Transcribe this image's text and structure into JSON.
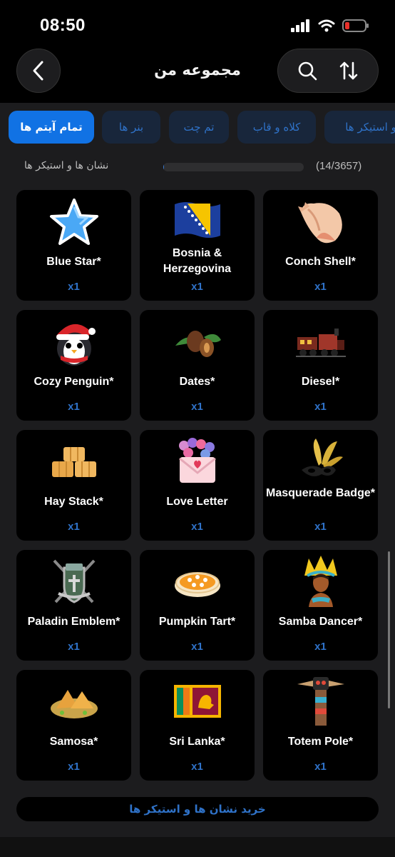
{
  "status": {
    "time": "08:50"
  },
  "header": {
    "title": "مجموعه من",
    "back_icon": "chevron-left-icon",
    "search_icon": "search-icon",
    "sort_icon": "sort-arrows-icon"
  },
  "tabs": [
    {
      "label": "تمام آیتم ها",
      "active": true
    },
    {
      "label": "بنر ها",
      "active": false
    },
    {
      "label": "تم چت",
      "active": false
    },
    {
      "label": "کلاه و قاب",
      "active": false
    },
    {
      "label": "نشان ها و استیکر ها",
      "active": false
    }
  ],
  "progress": {
    "count": "(14/3657)",
    "fraction": 0.0038,
    "label": "نشان ها و استیکر ها"
  },
  "items": [
    {
      "name": "Blue Star*",
      "qty": "x1",
      "icon": "blue-star-icon"
    },
    {
      "name": "Bosnia & Herzegovina",
      "qty": "x1",
      "icon": "bosnia-flag-icon"
    },
    {
      "name": "Conch Shell*",
      "qty": "x1",
      "icon": "conch-shell-icon"
    },
    {
      "name": "Cozy Penguin*",
      "qty": "x1",
      "icon": "penguin-icon"
    },
    {
      "name": "Dates*",
      "qty": "x1",
      "icon": "dates-icon"
    },
    {
      "name": "Diesel*",
      "qty": "x1",
      "icon": "train-icon"
    },
    {
      "name": "Hay Stack*",
      "qty": "x1",
      "icon": "hay-stack-icon"
    },
    {
      "name": "Love Letter",
      "qty": "x1",
      "icon": "love-letter-icon"
    },
    {
      "name": "Masquerade Badge*",
      "qty": "x1",
      "icon": "masquerade-mask-icon"
    },
    {
      "name": "Paladin Emblem*",
      "qty": "x1",
      "icon": "paladin-emblem-icon"
    },
    {
      "name": "Pumpkin Tart*",
      "qty": "x1",
      "icon": "pumpkin-tart-icon"
    },
    {
      "name": "Samba Dancer*",
      "qty": "x1",
      "icon": "samba-dancer-icon"
    },
    {
      "name": "Samosa*",
      "qty": "x1",
      "icon": "samosa-icon"
    },
    {
      "name": "Sri Lanka*",
      "qty": "x1",
      "icon": "sri-lanka-flag-icon"
    },
    {
      "name": "Totem Pole*",
      "qty": "x1",
      "icon": "totem-pole-icon"
    }
  ],
  "buy_label": "خرید نشان ها و استیکر ها",
  "colors": {
    "accent": "#1172e4",
    "link": "#2f72c8",
    "card": "#000000",
    "background": "#1c1c1e"
  }
}
